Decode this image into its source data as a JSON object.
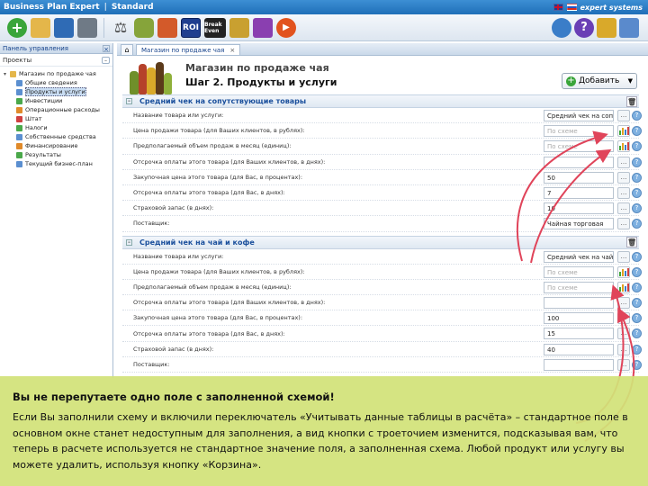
{
  "titlebar": {
    "app_name": "Business Plan Expert",
    "separator": "|",
    "edition": "Standard",
    "brand": "expert systems"
  },
  "toolbar": {
    "roi_label": "ROI",
    "break_even_label": "Break Even"
  },
  "left_panel": {
    "title": "Панель управления",
    "projects_label": "Проекты",
    "tree": [
      {
        "label": "Магазин по продаже чая",
        "level": 0,
        "icon": "folder-icon"
      },
      {
        "label": "Общие сведения",
        "level": 1,
        "icon": "doc-icon"
      },
      {
        "label": "Продукты и услуги",
        "level": 1,
        "icon": "doc-icon",
        "selected": true
      },
      {
        "label": "Инвестиции",
        "level": 1,
        "icon": "grn-icon"
      },
      {
        "label": "Операционные расходы",
        "level": 1,
        "icon": "org-icon"
      },
      {
        "label": "Штат",
        "level": 1,
        "icon": "red-icon"
      },
      {
        "label": "Налоги",
        "level": 1,
        "icon": "grn-icon"
      },
      {
        "label": "Собственные средства",
        "level": 1,
        "icon": "doc-icon"
      },
      {
        "label": "Финансирование",
        "level": 1,
        "icon": "org-icon"
      },
      {
        "label": "Результаты",
        "level": 1,
        "icon": "grn-icon"
      },
      {
        "label": "Текущий бизнес-план",
        "level": 1,
        "icon": "doc-icon"
      }
    ]
  },
  "tabs": {
    "active": "Магазин по продаже чая",
    "close": "×"
  },
  "header": {
    "project_title": "Магазин по продаже чая",
    "step_title": "Шаг 2. Продукты и услуги",
    "add_button": "Добавить"
  },
  "sections": [
    {
      "title": "Средний чек на сопутствующие товары",
      "rows": [
        {
          "label": "Название товара или услуги:",
          "value": "Средний чек на сопут",
          "button": "dots"
        },
        {
          "label": "Цена продажи товара (для Ваших клиентов, в рублях):",
          "value": "По схеме",
          "placeholder": true,
          "button": "chart"
        },
        {
          "label": "Предполагаемый объем продаж в месяц (единиц):",
          "value": "По схеме",
          "placeholder": true,
          "button": "chart"
        },
        {
          "label": "Отсрочка оплаты этого товара (для Ваших клиентов, в днях):",
          "value": "",
          "button": "dots"
        },
        {
          "label": "Закупочная цена этого товара (для Вас, в процентах):",
          "value": "50",
          "button": "dots"
        },
        {
          "label": "Отсрочка оплаты этого товара (для Вас, в днях):",
          "value": "7",
          "button": "dots"
        },
        {
          "label": "Страховой запас (в днях):",
          "value": "10",
          "button": "dots"
        },
        {
          "label": "Поставщик:",
          "value": "Чайная торговая",
          "button": "dots"
        }
      ]
    },
    {
      "title": "Средний чек на чай и кофе",
      "rows": [
        {
          "label": "Название товара или услуги:",
          "value": "Средний чек на чай и",
          "button": "dots"
        },
        {
          "label": "Цена продажи товара (для Ваших клиентов, в рублях):",
          "value": "По схеме",
          "placeholder": true,
          "button": "chart"
        },
        {
          "label": "Предполагаемый объем продаж в месяц (единиц):",
          "value": "По схеме",
          "placeholder": true,
          "button": "chart"
        },
        {
          "label": "Отсрочка оплаты этого товара (для Ваших клиентов, в днях):",
          "value": "",
          "button": "dots"
        },
        {
          "label": "Закупочная цена этого товара (для Вас, в процентах):",
          "value": "100",
          "button": "dots"
        },
        {
          "label": "Отсрочка оплаты этого товара (для Вас, в днях):",
          "value": "15",
          "button": "dots"
        },
        {
          "label": "Страховой запас (в днях):",
          "value": "40",
          "button": "dots"
        },
        {
          "label": "Поставщик:",
          "value": "",
          "button": "dots"
        }
      ]
    }
  ],
  "note": {
    "title": "Вы не перепутаете одно поле с заполненной схемой!",
    "body": "Если Вы заполнили схему и включили переключатель «Учитывать данные таблицы в расчёта» – стандартное поле в основном окне станет недоступным для заполнения, а вид кнопки с троеточием изменится, подсказывая вам, что теперь в расчете используется не стандартное значение поля, а заполненная схема. Любой продукт или услугу вы можете удалить, используя кнопку «Корзина»."
  },
  "colors": {
    "note_bg": "#d2e278",
    "arrow": "#e0445a",
    "section_title": "#1a4f9c"
  }
}
